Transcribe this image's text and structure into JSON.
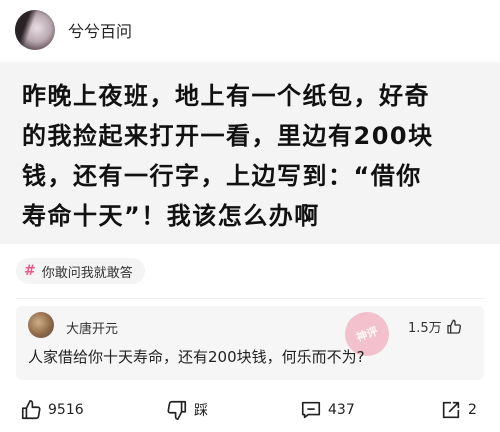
{
  "header": {
    "author": "兮兮百问"
  },
  "question": {
    "lines": [
      "昨晚上夜班，地上有一个纸包，好奇",
      "的我捡起来打开一看，里边有200块",
      "钱，还有一行字，上边写到：“借你",
      "寿命十天”！我该怎么办啊"
    ]
  },
  "topic": {
    "label": "你敢问我就敢答",
    "hash_color": "#e85b8a"
  },
  "answer": {
    "author": "大唐开元",
    "likes": "1.5万",
    "text": "人家借给你十天寿命，还有200块钱，何乐而不为?"
  },
  "actions": {
    "like_count": "9516",
    "dislike_label": "踩",
    "comment_count": "437",
    "share_count": "2"
  }
}
